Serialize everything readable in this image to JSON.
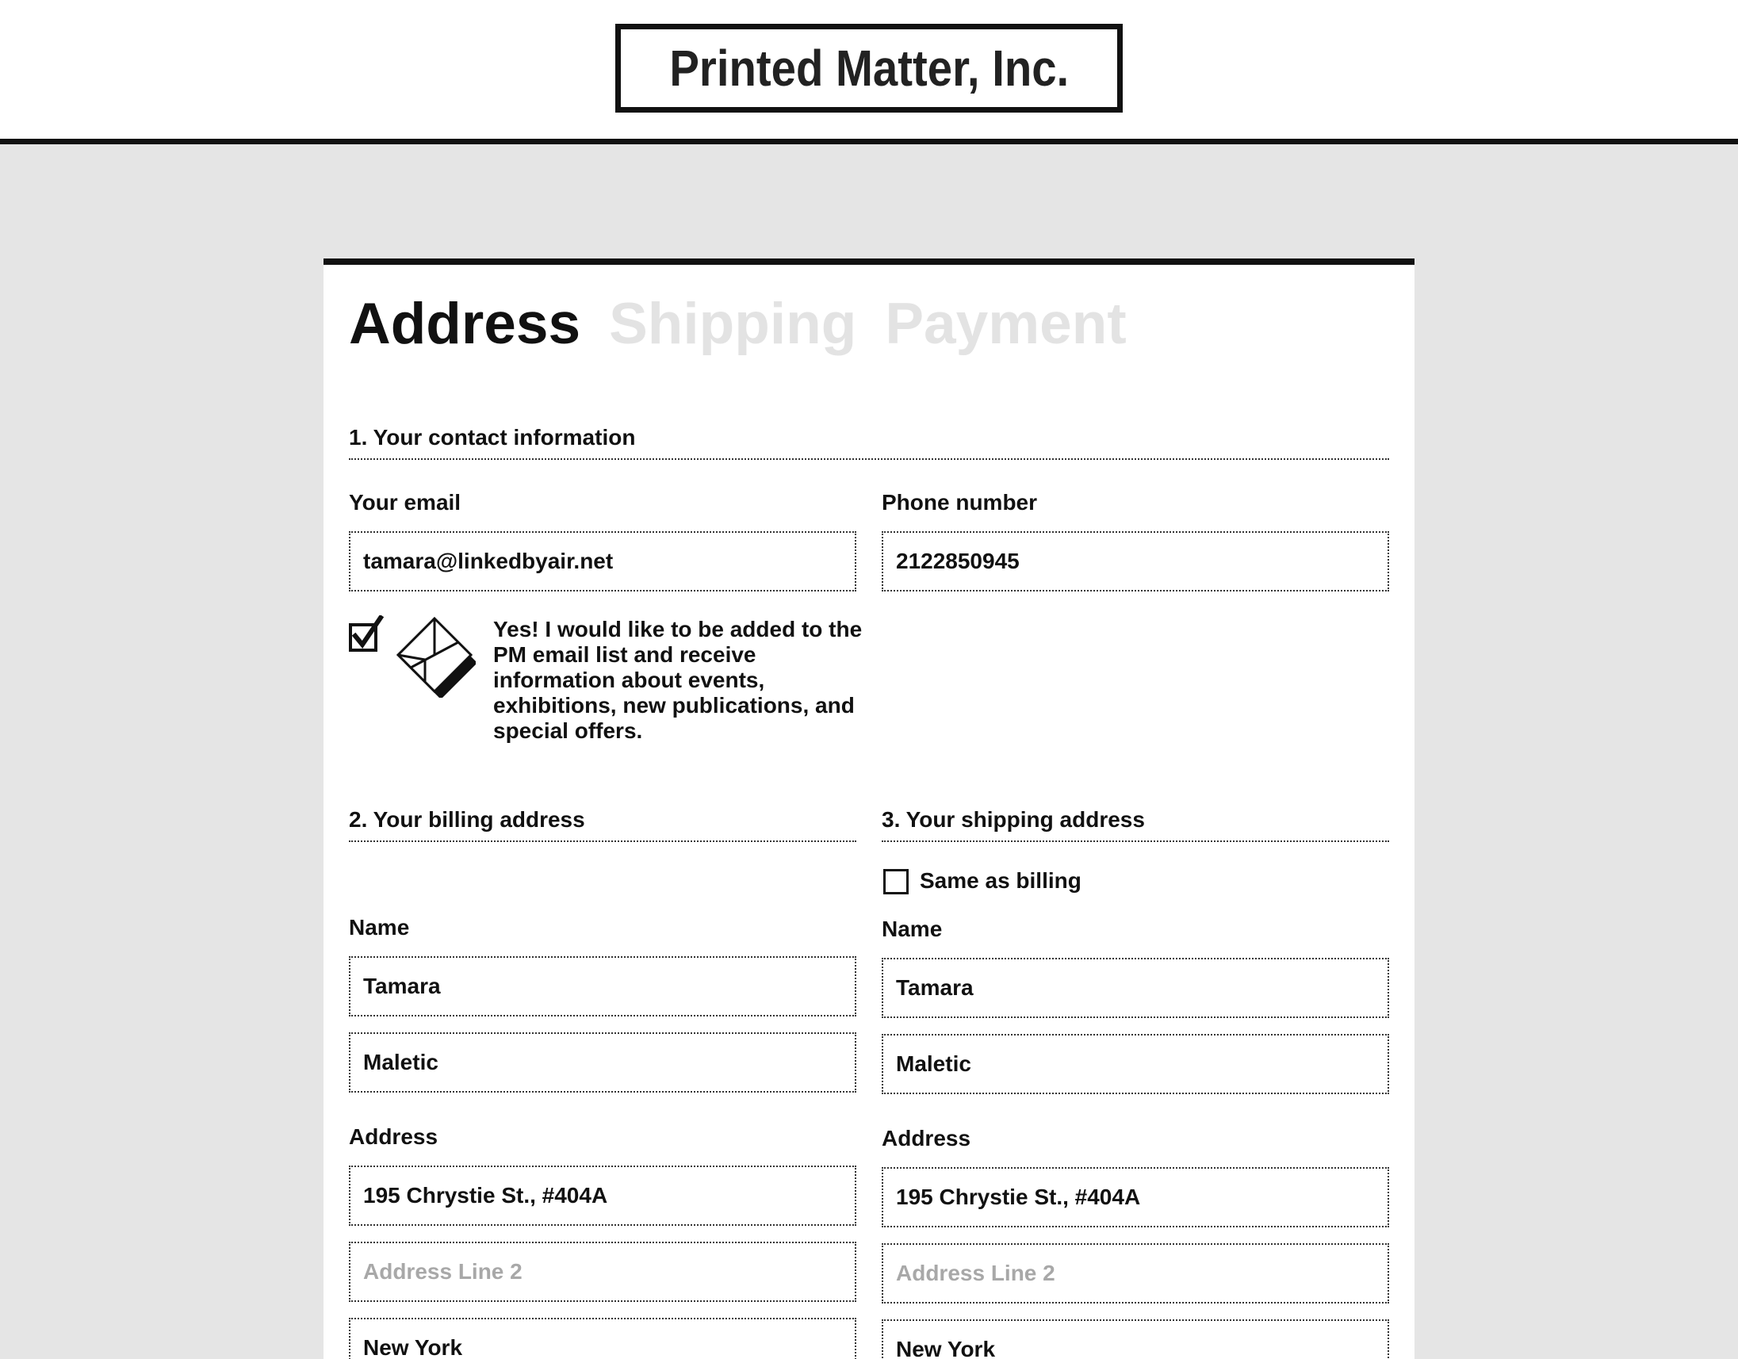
{
  "header": {
    "logo_text": "Printed Matter, Inc."
  },
  "steps": [
    {
      "label": "Address",
      "active": true
    },
    {
      "label": "Shipping",
      "active": false
    },
    {
      "label": "Payment",
      "active": false
    }
  ],
  "contact": {
    "section_title": "1. Your contact information",
    "email_label": "Your email",
    "email_value": "tamara@linkedbyair.net",
    "phone_label": "Phone number",
    "phone_value": "2122850945",
    "newsletter_checked": true,
    "newsletter_text": "Yes! I would like to be added to the PM email list and receive information about events, exhibitions, new publications, and special offers."
  },
  "billing": {
    "section_title": "2. Your billing address",
    "name_label": "Name",
    "first_name": "Tamara",
    "last_name": "Maletic",
    "address_label": "Address",
    "address_line1": "195 Chrystie St., #404A",
    "address_line2_placeholder": "Address Line 2",
    "city": "New York"
  },
  "shipping": {
    "section_title": "3. Your shipping address",
    "same_as_billing_label": "Same as billing",
    "same_as_billing_checked": false,
    "name_label": "Name",
    "first_name": "Tamara",
    "last_name": "Maletic",
    "address_label": "Address",
    "address_line1": "195 Chrystie St., #404A",
    "address_line2_placeholder": "Address Line 2",
    "city": "New York"
  },
  "colors": {
    "background": "#e5e5e5",
    "text": "#111111",
    "inactive_step": "#e3e3e3",
    "placeholder": "#a8a8a8"
  }
}
